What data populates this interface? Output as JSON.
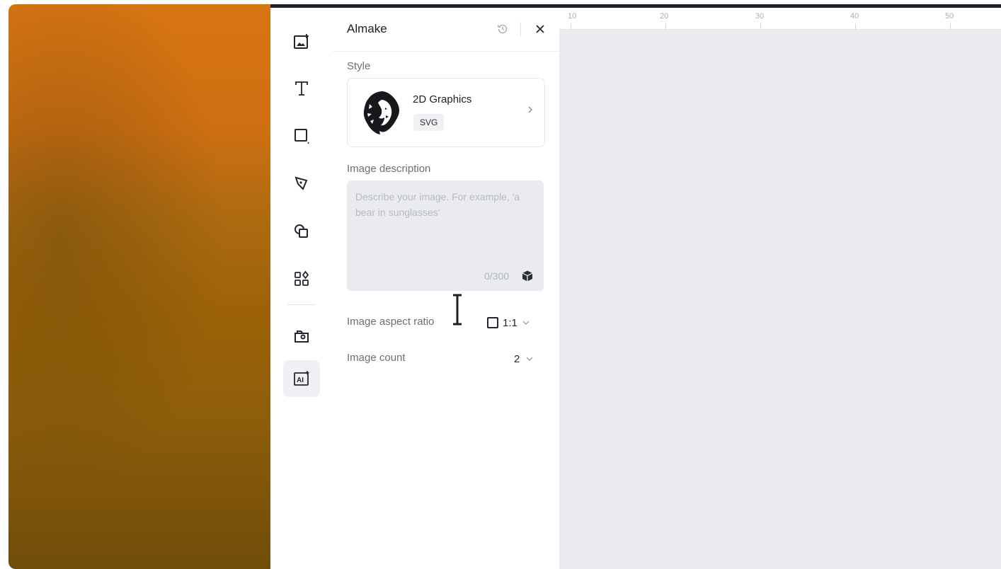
{
  "panel": {
    "title": "Almake",
    "style_label": "Style",
    "style_card": {
      "name": "2D Graphics",
      "tag": "SVG"
    },
    "description_label": "Image description",
    "description_placeholder": "Describe your image. For example, 'a bear in sunglasses'",
    "description_value": "",
    "description_count": "0/300",
    "aspect_ratio_label": "Image aspect ratio",
    "aspect_ratio_value": "1:1",
    "image_count_label": "Image count",
    "image_count_value": "2"
  },
  "rail": {
    "tools": [
      {
        "name": "image-upload",
        "icon": "image-plus-icon"
      },
      {
        "name": "text",
        "icon": "text-icon"
      },
      {
        "name": "shape",
        "icon": "shape-icon"
      },
      {
        "name": "pen",
        "icon": "pen-icon"
      },
      {
        "name": "elements",
        "icon": "elements-icon"
      },
      {
        "name": "apps",
        "icon": "apps-icon"
      },
      {
        "name": "assets",
        "icon": "folder-icon"
      },
      {
        "name": "ai-image",
        "icon": "ai-icon",
        "active": true
      }
    ]
  },
  "ruler": {
    "ticks": [
      "10",
      "20",
      "30",
      "40",
      "50"
    ]
  },
  "colors": {
    "canvas": "#e9ebef",
    "panel": "#ffffff",
    "text": "#1c1f25",
    "muted": "#6b7078"
  }
}
